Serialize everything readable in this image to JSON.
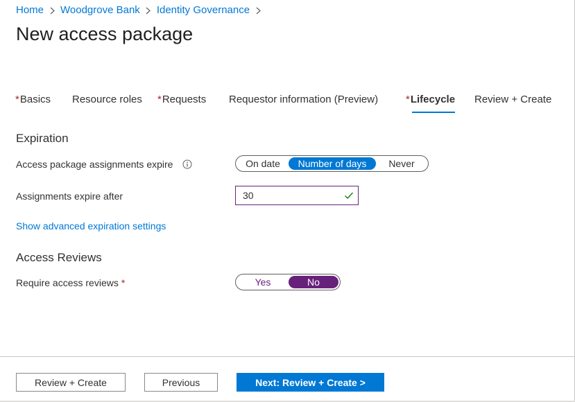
{
  "breadcrumb": {
    "items": [
      "Home",
      "Woodgrove Bank",
      "Identity Governance"
    ]
  },
  "page": {
    "title": "New access package"
  },
  "tabs": [
    {
      "label": "Basics",
      "required": "*"
    },
    {
      "label": "Resource roles",
      "required": ""
    },
    {
      "label": "Requests",
      "required": "*"
    },
    {
      "label": "Requestor information (Preview)",
      "required": ""
    },
    {
      "label": "Lifecycle",
      "required": "*"
    },
    {
      "label": "Review + Create",
      "required": ""
    }
  ],
  "selected_tab": "Lifecycle",
  "expiration": {
    "heading": "Expiration",
    "assignments_expire_label": "Access package assignments expire",
    "options": [
      "On date",
      "Number of days",
      "Never"
    ],
    "selected_option": "Number of days",
    "expire_after_label": "Assignments expire after",
    "expire_after_value": "30",
    "advanced_link": "Show advanced expiration settings"
  },
  "access_reviews": {
    "heading": "Access Reviews",
    "require_label": "Require access reviews",
    "required_marker": "*",
    "options": [
      "Yes",
      "No"
    ],
    "selected_option": "No"
  },
  "footer": {
    "review_create": "Review + Create",
    "previous": "Previous",
    "next": "Next: Review + Create >"
  },
  "colors": {
    "accent_blue": "#0078d4",
    "accent_purple": "#68217a",
    "required_red": "#a4262c",
    "valid_green": "#107c10"
  },
  "icons": {
    "breadcrumb_separator": "chevron-right-icon",
    "info": "info-icon",
    "valid": "checkmark-icon"
  }
}
